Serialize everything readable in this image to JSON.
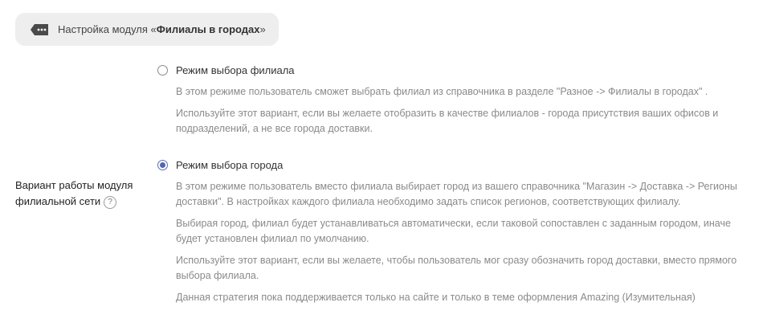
{
  "header": {
    "tab_prefix": "Настройка модуля «",
    "tab_module_name": "Филиалы в городах",
    "tab_suffix": "»",
    "icon": "tag-icon"
  },
  "field": {
    "label_line1": "Вариант работы модуля",
    "label_line2": "филиальной сети",
    "help": "?"
  },
  "options": [
    {
      "title": "Режим выбора филиала",
      "checked": false,
      "descriptions": [
        "В этом режиме пользователь сможет выбрать филиал из справочника в разделе \"Разное -> Филиалы в городах\" .",
        "Используйте этот вариант, если вы желаете отобразить в качестве филиалов - города присутствия ваших офисов и подразделений, а не все города доставки."
      ]
    },
    {
      "title": "Режим выбора города",
      "checked": true,
      "descriptions": [
        "В этом режиме пользователь вместо филиала выбирает город из вашего справочника \"Магазин -> Доставка -> Регионы доставки\". В настройках каждого филиала необходимо задать список регионов, соответствующих филиалу.",
        "Выбирая город, филиал будет устанавливаться автоматически, если таковой сопоставлен с заданным городом, иначе будет установлен филиал по умолчанию.",
        "Используйте этот вариант, если вы желаете, чтобы пользователь мог сразу обозначить город доставки, вместо прямого выбора филиала.",
        "Данная стратегия пока поддерживается только на сайте и только в теме оформления Amazing (Изумительная)"
      ]
    }
  ],
  "colors": {
    "tab_bg": "#eeeeee",
    "radio_checked": "#5065b4",
    "desc_text": "#8a8a8a"
  }
}
